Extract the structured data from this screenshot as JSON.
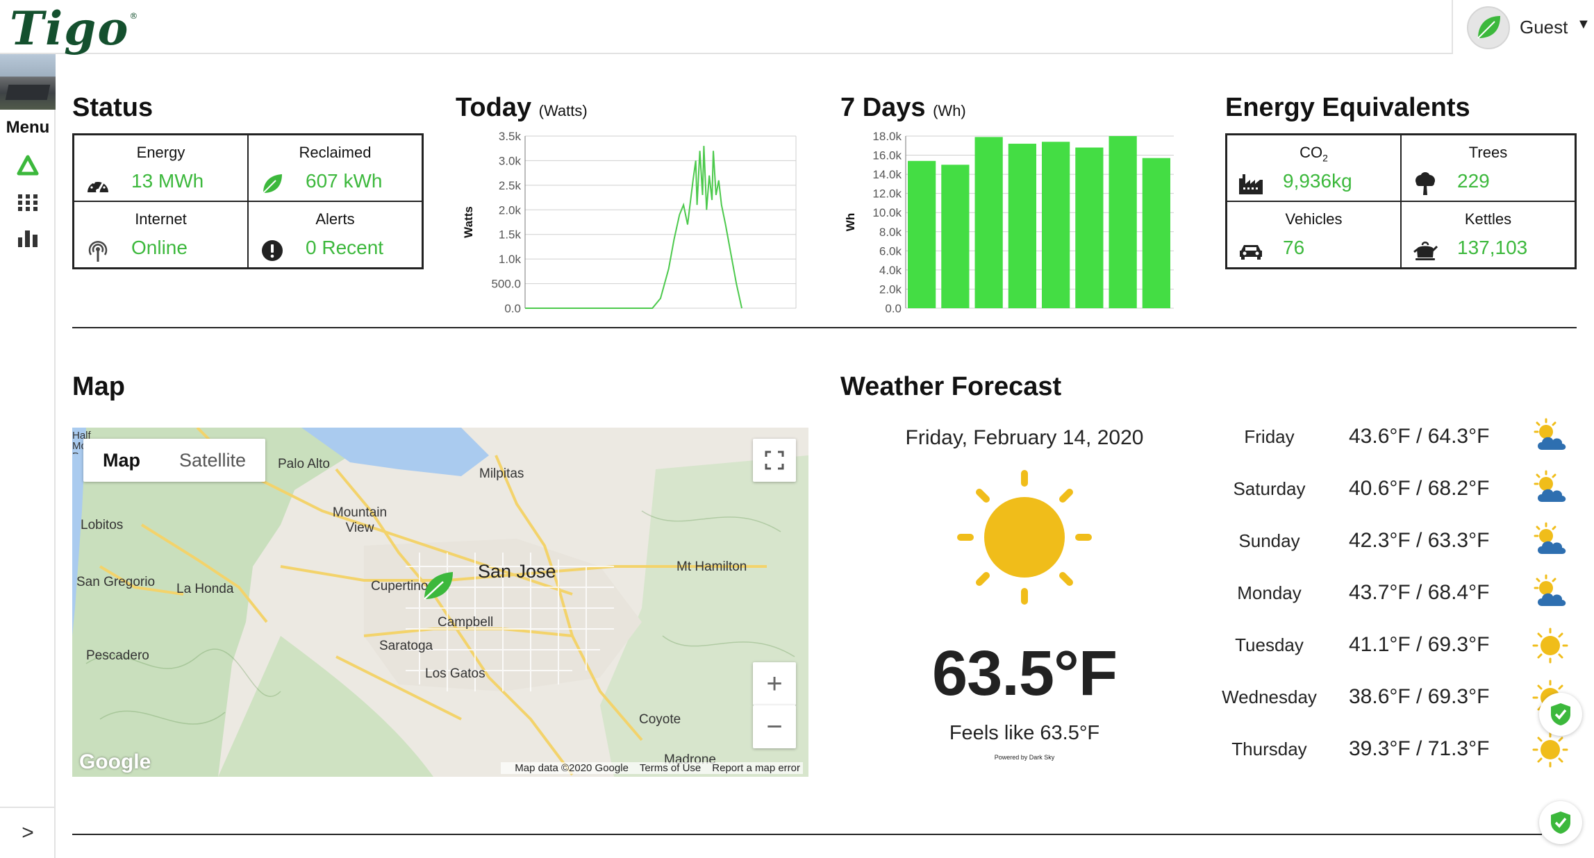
{
  "app": {
    "logo_text": "Tigo",
    "logo_mark": "®"
  },
  "user": {
    "name": "Guest",
    "caret": "▼"
  },
  "sidebar": {
    "menu_label": "Menu",
    "collapse_glyph": ">"
  },
  "status": {
    "title": "Status",
    "cells": [
      {
        "label": "Energy",
        "value": "13 MWh",
        "icon": "gauge-icon"
      },
      {
        "label": "Reclaimed",
        "value": "607 kWh",
        "icon": "leaf-icon"
      },
      {
        "label": "Internet",
        "value": "Online",
        "icon": "antenna-icon"
      },
      {
        "label": "Alerts",
        "value": "0 Recent",
        "icon": "alert-icon"
      }
    ]
  },
  "today_chart": {
    "title": "Today",
    "unit": "(Watts)",
    "chart_data": {
      "type": "line",
      "ylabel": "Watts",
      "ylim": [
        0,
        3500
      ],
      "yticks": [
        "3.5k",
        "3.0k",
        "2.5k",
        "2.0k",
        "1.5k",
        "1.0k",
        "500.0",
        "0.0"
      ],
      "grid": true,
      "color": "#4cc94c",
      "x": [
        0.0,
        0.47,
        0.5,
        0.53,
        0.55,
        0.57,
        0.585,
        0.6,
        0.62,
        0.63,
        0.635,
        0.645,
        0.655,
        0.66,
        0.67,
        0.68,
        0.69,
        0.695,
        0.705,
        0.715,
        0.725,
        0.74,
        0.76,
        0.78,
        0.8
      ],
      "y": [
        0,
        0,
        200,
        800,
        1400,
        1900,
        2100,
        1700,
        2600,
        3000,
        2100,
        3200,
        2300,
        3300,
        2000,
        2700,
        2200,
        3200,
        2300,
        2600,
        2100,
        1700,
        1100,
        500,
        0
      ]
    }
  },
  "week_chart": {
    "title": "7 Days",
    "unit": "(Wh)",
    "chart_data": {
      "type": "bar",
      "ylabel": "Wh",
      "ylim": [
        0,
        18000
      ],
      "yticks": [
        "18.0k",
        "16.0k",
        "14.0k",
        "12.0k",
        "10.0k",
        "8.0k",
        "6.0k",
        "4.0k",
        "2.0k",
        "0.0"
      ],
      "values": [
        15400,
        15000,
        17900,
        17200,
        17400,
        16800,
        18000,
        15700
      ],
      "color": "#44dd44",
      "grid": true
    }
  },
  "equivalents": {
    "title": "Energy Equivalents",
    "co2_label": "CO",
    "co2_sub": "2",
    "cells": [
      {
        "value": "9,936kg",
        "icon": "factory-icon"
      },
      {
        "label": "Trees",
        "value": "229",
        "icon": "tree-icon"
      },
      {
        "label": "Vehicles",
        "value": "76",
        "icon": "car-icon"
      },
      {
        "label": "Kettles",
        "value": "137,103",
        "icon": "kettle-icon"
      }
    ]
  },
  "map": {
    "title": "Map",
    "tabs": [
      "Map",
      "Satellite"
    ],
    "places": [
      "Palo Alto",
      "Milpitas",
      "Mountain View",
      "Lobitos",
      "San Jose",
      "Mt Hamilton",
      "Cupertino",
      "San Gregorio",
      "La Honda",
      "Campbell",
      "Saratoga",
      "Pescadero",
      "Los Gatos",
      "Coyote",
      "Madrone",
      "Half Moon Bay"
    ],
    "footer": {
      "data": "Map data ©2020 Google",
      "terms": "Terms of Use",
      "report": "Report a map error"
    },
    "google": "Google",
    "zoom_in": "+",
    "zoom_out": "−"
  },
  "weather": {
    "title": "Weather Forecast",
    "date": "Friday, February 14, 2020",
    "temp": "63.5°F",
    "feels": "Feels like 63.5°F",
    "powered": "Powered by Dark Sky",
    "forecast": [
      {
        "day": "Friday",
        "temp": "43.6°F / 64.3°F",
        "icon": "partly-cloudy-icon"
      },
      {
        "day": "Saturday",
        "temp": "40.6°F / 68.2°F",
        "icon": "partly-cloudy-icon"
      },
      {
        "day": "Sunday",
        "temp": "42.3°F / 63.3°F",
        "icon": "partly-cloudy-icon"
      },
      {
        "day": "Monday",
        "temp": "43.7°F / 68.4°F",
        "icon": "partly-cloudy-icon"
      },
      {
        "day": "Tuesday",
        "temp": "41.1°F / 69.3°F",
        "icon": "sun-icon"
      },
      {
        "day": "Wednesday",
        "temp": "38.6°F / 69.3°F",
        "icon": "sun-icon"
      },
      {
        "day": "Thursday",
        "temp": "39.3°F / 71.3°F",
        "icon": "sun-icon"
      }
    ]
  },
  "colors": {
    "accent": "#3cb83c",
    "brand": "#14502e",
    "sun": "#f0bd1a",
    "cloud": "#2e6fb0"
  }
}
